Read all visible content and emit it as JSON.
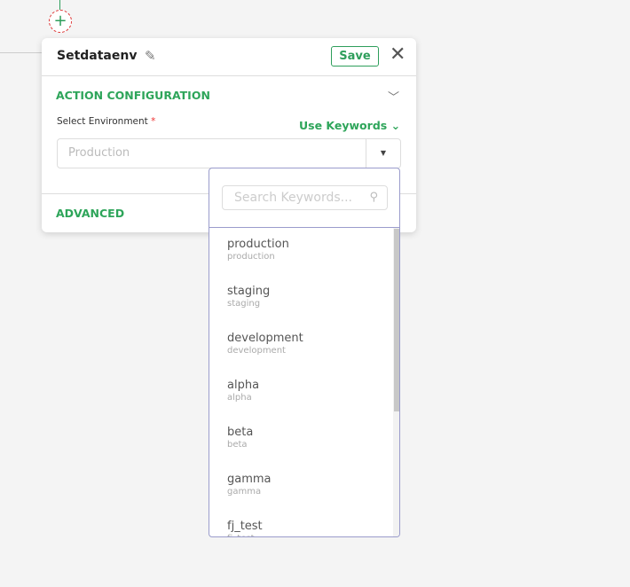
{
  "node": {
    "add_icon": "plus-icon"
  },
  "panel": {
    "title": "Setdataenv",
    "save_label": "Save",
    "action_section": "ACTION CONFIGURATION",
    "advanced_section": "ADVANCED",
    "field_label": "Select Environment",
    "required_mark": "*",
    "use_keywords": "Use Keywords",
    "value": "Production"
  },
  "dropdown": {
    "search_placeholder": "Search Keywords...",
    "items": [
      {
        "primary": "production",
        "secondary": "production"
      },
      {
        "primary": "staging",
        "secondary": "staging"
      },
      {
        "primary": "development",
        "secondary": "development"
      },
      {
        "primary": "alpha",
        "secondary": "alpha"
      },
      {
        "primary": "beta",
        "secondary": "beta"
      },
      {
        "primary": "gamma",
        "secondary": "gamma"
      },
      {
        "primary": "fj_test",
        "secondary": "fj_test"
      }
    ]
  },
  "colors": {
    "accent": "#2ea55a",
    "required": "#e33333",
    "dropdown_border": "#9a9ccc"
  }
}
